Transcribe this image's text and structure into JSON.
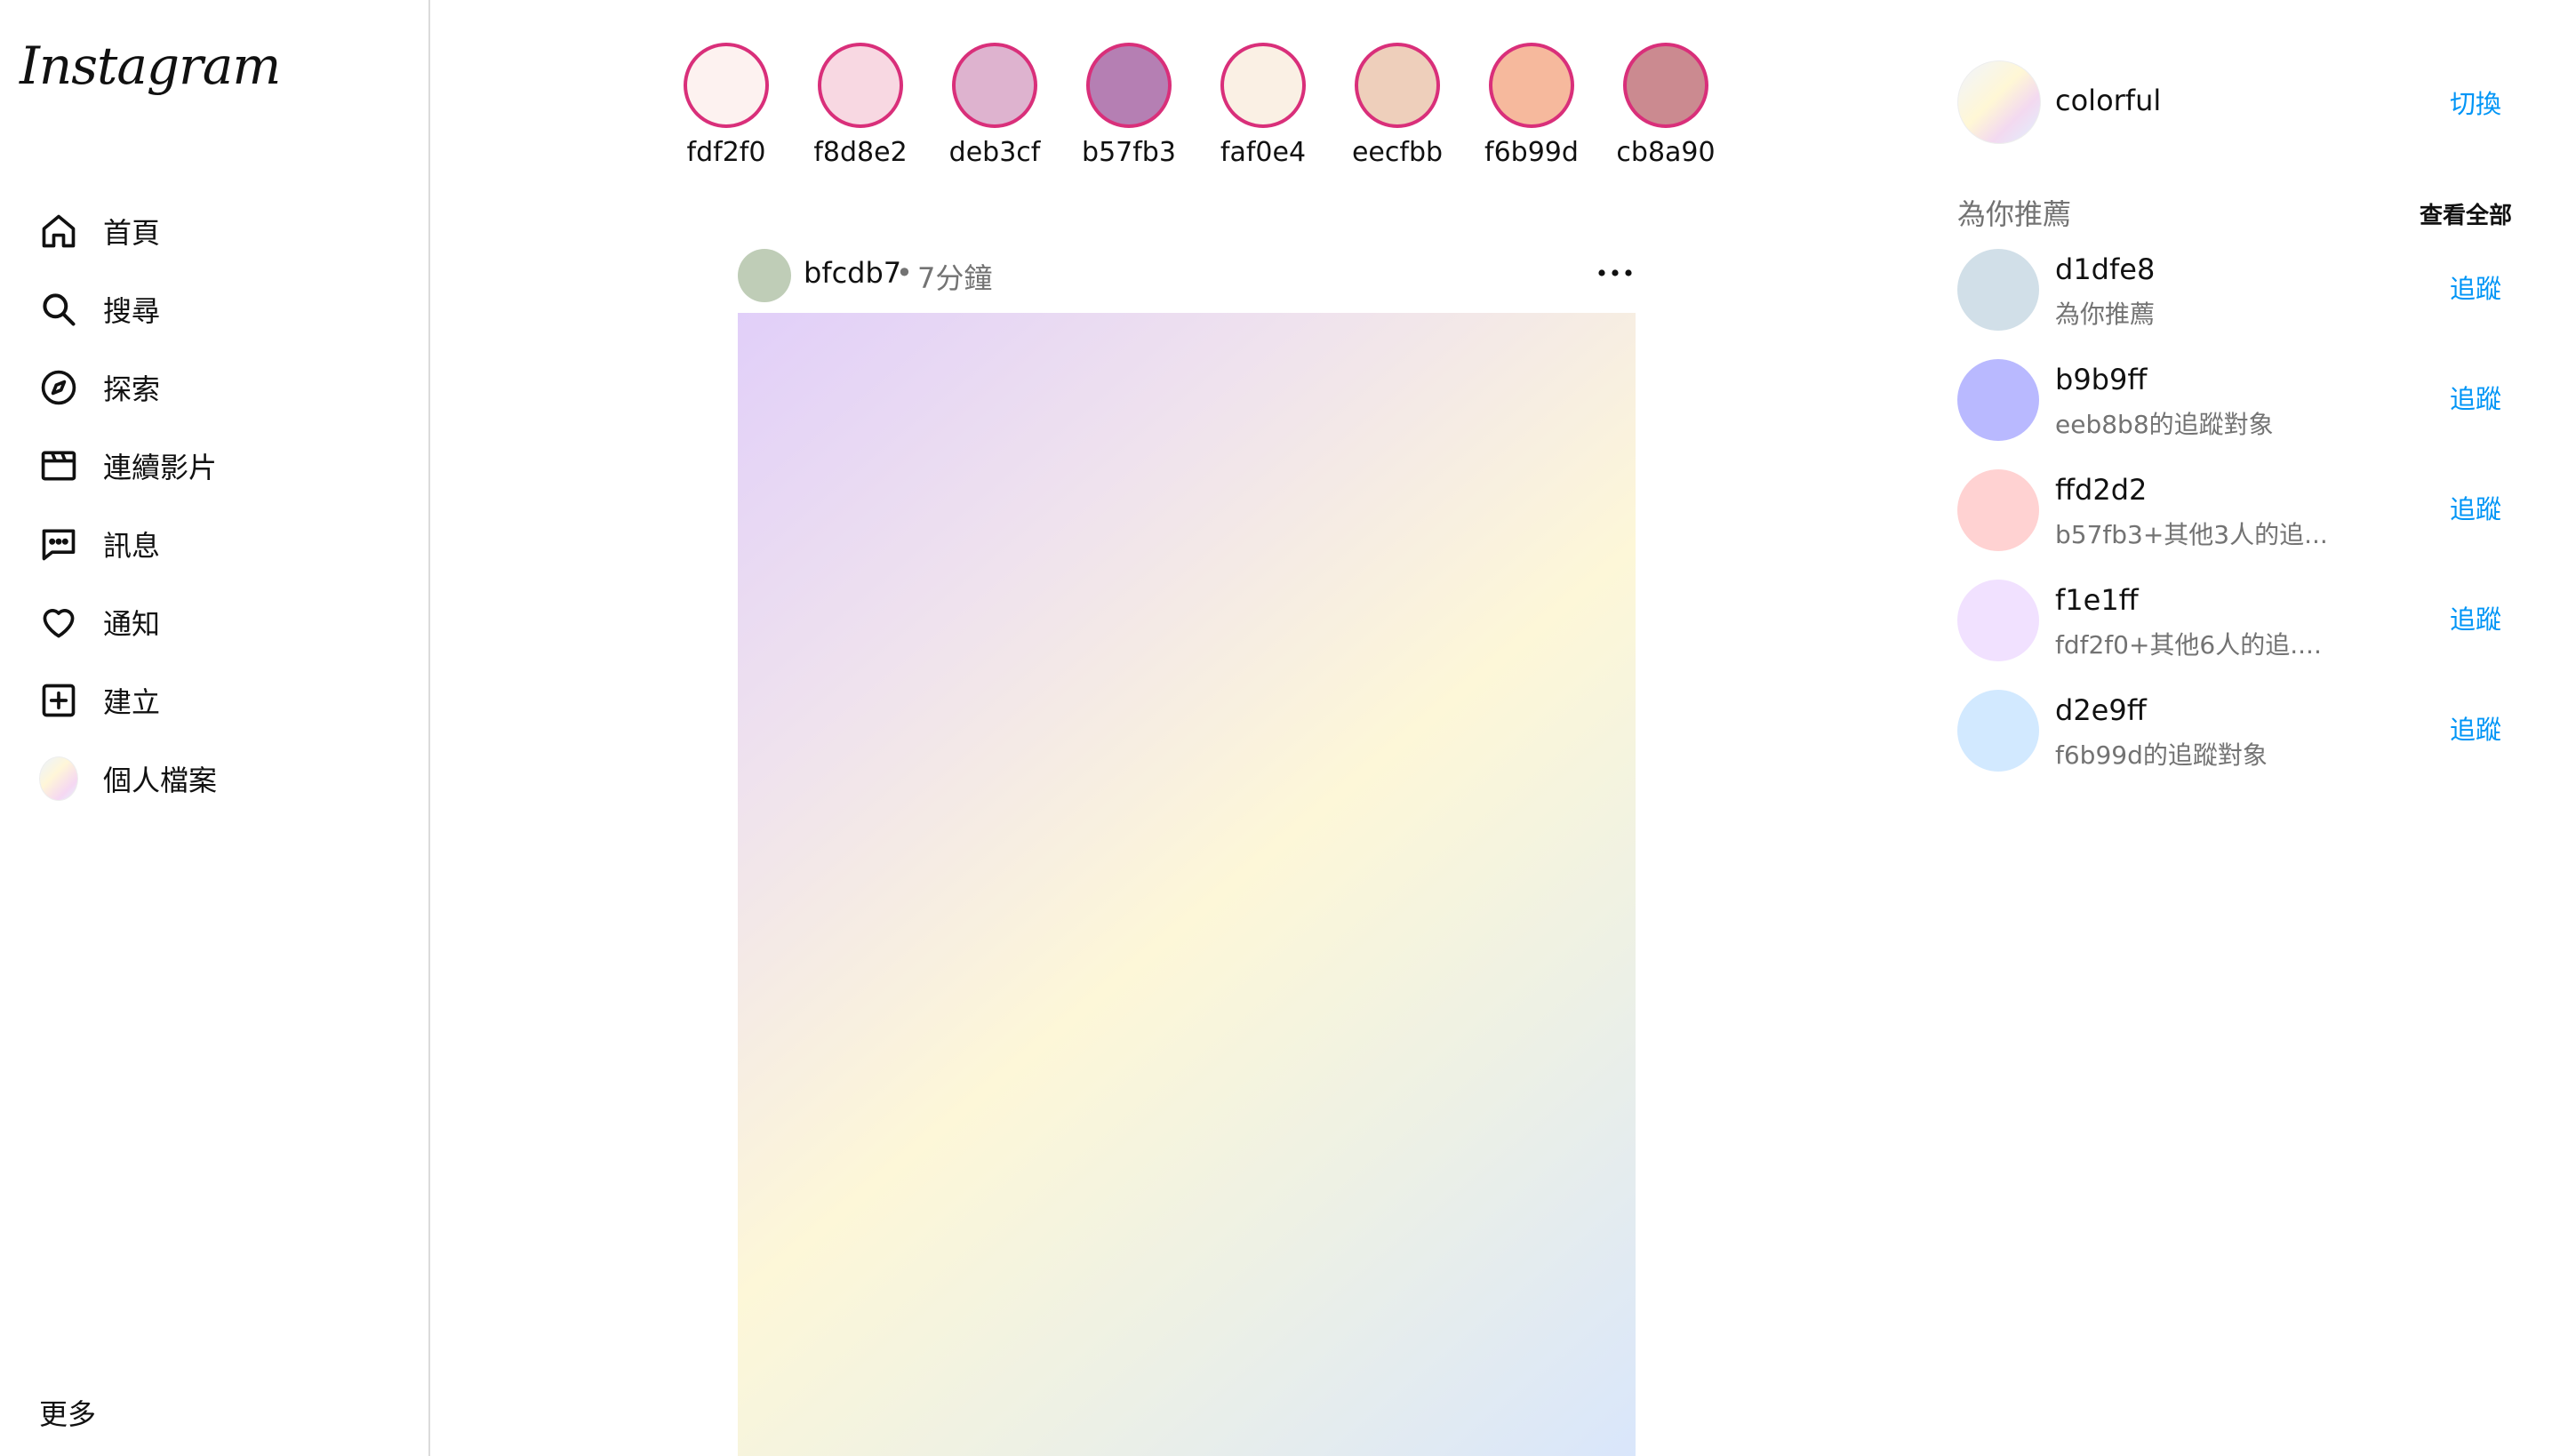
{
  "sidebar": {
    "logo": "Instagram",
    "items": [
      {
        "label": "首頁",
        "icon": "home-icon"
      },
      {
        "label": "搜尋",
        "icon": "search-icon"
      },
      {
        "label": "探索",
        "icon": "compass-icon"
      },
      {
        "label": "連續影片",
        "icon": "reels-icon"
      },
      {
        "label": "訊息",
        "icon": "message-icon"
      },
      {
        "label": "通知",
        "icon": "heart-icon"
      },
      {
        "label": "建立",
        "icon": "plus-square-icon"
      },
      {
        "label": "個人檔案",
        "icon": "profile-avatar"
      }
    ],
    "more": "更多"
  },
  "stories": [
    {
      "name": "fdf2f0",
      "color": "#fdf2f0"
    },
    {
      "name": "f8d8e2",
      "color": "#f8d8e2"
    },
    {
      "name": "deb3cf",
      "color": "#deb3cf"
    },
    {
      "name": "b57fb3",
      "color": "#b57fb3"
    },
    {
      "name": "faf0e4",
      "color": "#faf0e4"
    },
    {
      "name": "eecfbb",
      "color": "#eecfbb"
    },
    {
      "name": "f6b99d",
      "color": "#f6b99d"
    },
    {
      "name": "cb8a90",
      "color": "#cb8a90"
    }
  ],
  "post": {
    "username": "bfcdb7",
    "avatar_color": "#bfcdb7",
    "separator": "•",
    "time": "7分鐘",
    "more_icon": "more-horizontal-icon"
  },
  "right": {
    "username": "colorful",
    "switch": "切換",
    "suggest_title": "為你推薦",
    "see_all": "查看全部",
    "suggestions": [
      {
        "name": "d1dfe8",
        "sub": "為你推薦",
        "color": "#d1dfe8",
        "follow": "追蹤"
      },
      {
        "name": "b9b9ff",
        "sub": "eeb8b8的追蹤對象",
        "color": "#b9b9ff",
        "follow": "追蹤"
      },
      {
        "name": "ffd2d2",
        "sub": "b57fb3+其他3人的追...",
        "color": "#ffd2d2",
        "follow": "追蹤"
      },
      {
        "name": "f1e1ff",
        "sub": "fdf2f0+其他6人的追....",
        "color": "#f1e1ff",
        "follow": "追蹤"
      },
      {
        "name": "d2e9ff",
        "sub": "f6b99d的追蹤對象",
        "color": "#d2e9ff",
        "follow": "追蹤"
      }
    ]
  }
}
